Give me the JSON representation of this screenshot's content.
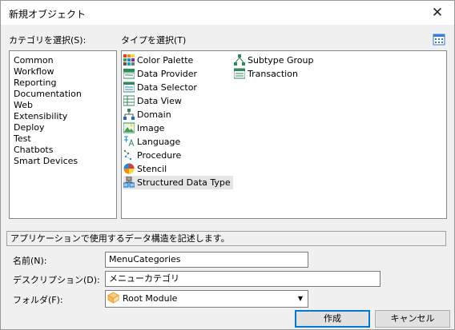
{
  "window": {
    "title": "新規オブジェクト",
    "close_glyph": "✕"
  },
  "categories": {
    "label": "カテゴリを選択(S):",
    "items": [
      "Common",
      "Workflow",
      "Reporting",
      "Documentation",
      "Web",
      "Extensibility",
      "Deploy",
      "Test",
      "Chatbots",
      "Smart Devices"
    ]
  },
  "types": {
    "label": "タイプを選択(T)",
    "items": [
      {
        "label": "Color Palette",
        "icon": "color-palette-icon"
      },
      {
        "label": "Data Provider",
        "icon": "data-provider-icon"
      },
      {
        "label": "Data Selector",
        "icon": "data-selector-icon"
      },
      {
        "label": "Data View",
        "icon": "data-view-icon"
      },
      {
        "label": "Domain",
        "icon": "domain-icon"
      },
      {
        "label": "Image",
        "icon": "image-icon"
      },
      {
        "label": "Language",
        "icon": "language-icon"
      },
      {
        "label": "Procedure",
        "icon": "procedure-icon"
      },
      {
        "label": "Stencil",
        "icon": "stencil-icon"
      },
      {
        "label": "Structured Data Type",
        "icon": "structured-data-type-icon",
        "selected": true
      },
      {
        "label": "Subtype Group",
        "icon": "subtype-group-icon"
      },
      {
        "label": "Transaction",
        "icon": "transaction-icon"
      }
    ]
  },
  "description_text": "アプリケーションで使用するデータ構造を記述します。",
  "form": {
    "name_label": "名前(N):",
    "name_value": "MenuCategories",
    "desc_label": "デスクリプション(D):",
    "desc_value": "メニューカテゴリ",
    "folder_label": "フォルダ(F):",
    "folder_value": "Root Module"
  },
  "buttons": {
    "create": "作成",
    "cancel": "キャンセル"
  },
  "colors": {
    "accent": "#0078d7",
    "selected_bg": "#e5e5e5",
    "panel_border": "#828790"
  }
}
